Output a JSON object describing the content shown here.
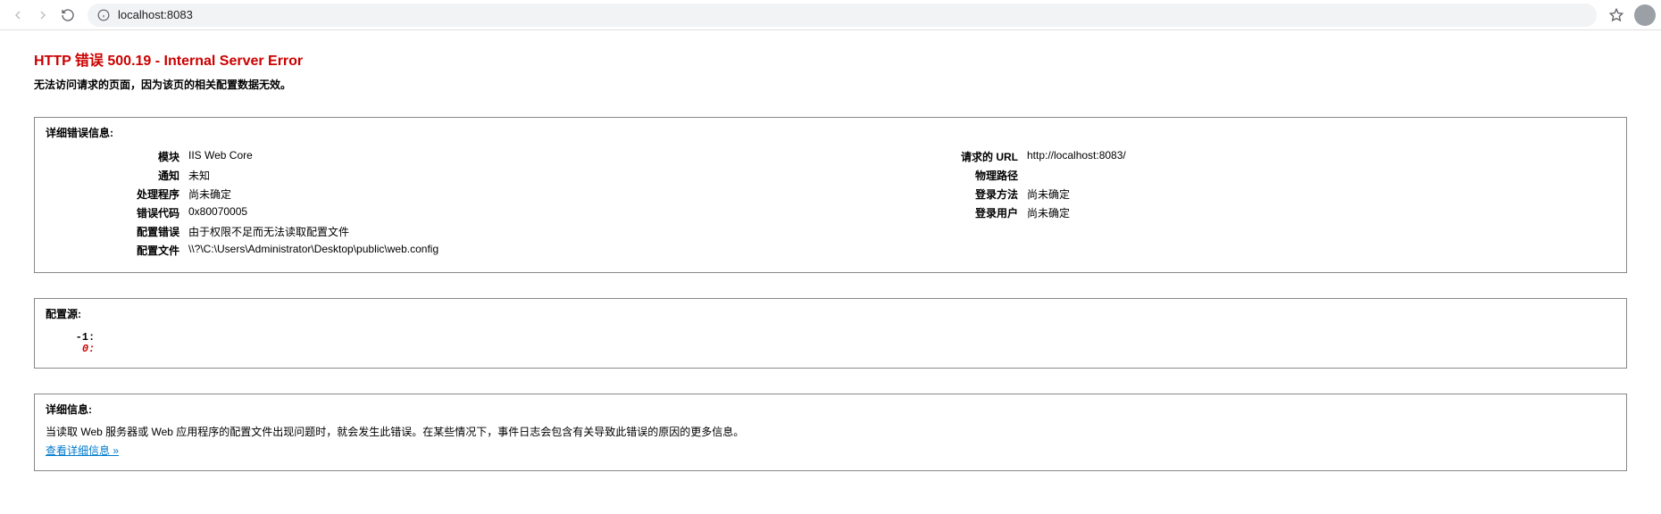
{
  "browser": {
    "url_display": "localhost:8083"
  },
  "error": {
    "title": "HTTP 错误 500.19 - Internal Server Error",
    "subtitle": "无法访问请求的页面，因为该页的相关配置数据无效。"
  },
  "details": {
    "heading": "详细错误信息:",
    "left": [
      {
        "label": "模块",
        "value": "IIS Web Core"
      },
      {
        "label": "通知",
        "value": "未知"
      },
      {
        "label": "处理程序",
        "value": "尚未确定"
      },
      {
        "label": "错误代码",
        "value": "0x80070005"
      },
      {
        "label": "配置错误",
        "value": "由于权限不足而无法读取配置文件"
      },
      {
        "label": "配置文件",
        "value": "\\\\?\\C:\\Users\\Administrator\\Desktop\\public\\web.config"
      }
    ],
    "right": [
      {
        "label": "请求的 URL",
        "value": "http://localhost:8083/"
      },
      {
        "label": "物理路径",
        "value": ""
      },
      {
        "label": "登录方法",
        "value": "尚未确定"
      },
      {
        "label": "登录用户",
        "value": "尚未确定"
      }
    ]
  },
  "config_source": {
    "heading": "配置源:",
    "line_neg1_label": "-1:",
    "line_0_label": "0:",
    "line_neg1_text": "",
    "line_0_text": ""
  },
  "more_info": {
    "heading": "详细信息:",
    "text": "当读取 Web 服务器或 Web 应用程序的配置文件出现问题时，就会发生此错误。在某些情况下，事件日志会包含有关导致此错误的原因的更多信息。",
    "link_text": "查看详细信息 »"
  }
}
